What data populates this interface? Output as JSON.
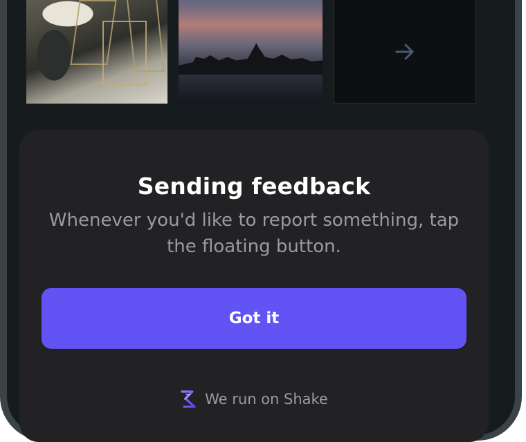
{
  "sheet": {
    "title": "Sending feedback",
    "body": "Whenever you'd like to report something, tap the floating button.",
    "button_label": "Got it"
  },
  "footer": {
    "text": "We run on Shake",
    "logo_icon": "shake-logo-icon"
  },
  "gallery": {
    "items": [
      {
        "icon": "photo-vases"
      },
      {
        "icon": "photo-city-skyline"
      },
      {
        "icon": "arrow-right-icon"
      }
    ]
  },
  "colors": {
    "accent": "#6253f5",
    "sheet_background": "#222124",
    "title": "#ffffff",
    "body_text": "#9b9a9f",
    "frame": "#3a4346"
  }
}
